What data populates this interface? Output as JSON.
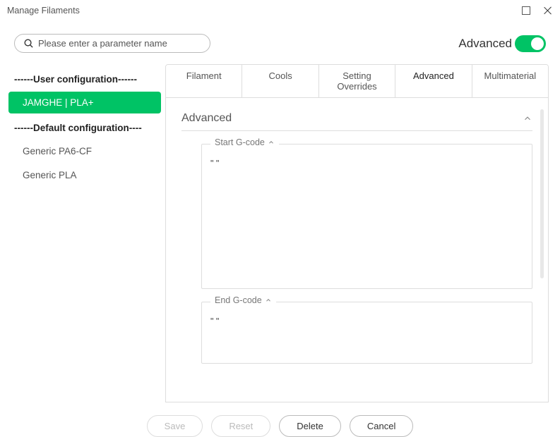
{
  "titlebar": {
    "title": "Manage Filaments"
  },
  "search": {
    "placeholder": "Please enter a parameter name"
  },
  "advanced": {
    "label": "Advanced"
  },
  "sidebar": {
    "user_header": "------User configuration------",
    "default_header": "------Default configuration----",
    "user_items": [
      {
        "label": "JAMGHE | PLA+",
        "selected": true
      }
    ],
    "default_items": [
      {
        "label": "Generic PA6-CF",
        "selected": false
      },
      {
        "label": "Generic PLA",
        "selected": false
      }
    ]
  },
  "tabs": [
    {
      "id": "filament",
      "label": "Filament",
      "active": false
    },
    {
      "id": "cools",
      "label": "Cools",
      "active": false
    },
    {
      "id": "overrides",
      "label": "Setting Overrides",
      "active": false
    },
    {
      "id": "advanced",
      "label": "Advanced",
      "active": true
    },
    {
      "id": "multimaterial",
      "label": "Multimaterial",
      "active": false
    }
  ],
  "panel": {
    "section_title": "Advanced",
    "start_gcode": {
      "legend": "Start G-code",
      "value": "\" \""
    },
    "end_gcode": {
      "legend": "End G-code",
      "value": "\" \""
    }
  },
  "footer": {
    "save": "Save",
    "reset": "Reset",
    "delete": "Delete",
    "cancel": "Cancel"
  }
}
